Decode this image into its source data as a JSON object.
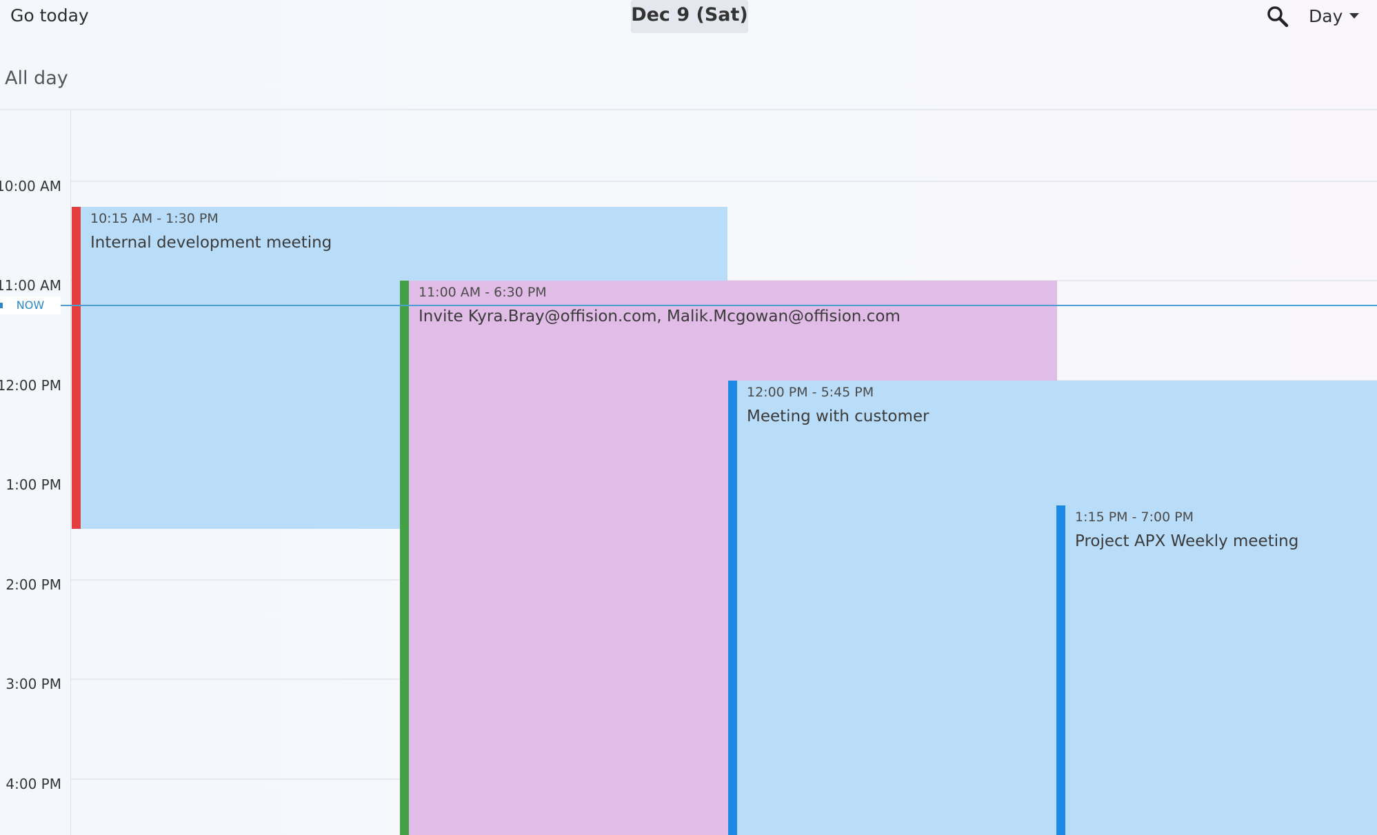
{
  "header": {
    "go_today_label": "Go today",
    "date_title": "Dec 9 (Sat)",
    "search_icon": "search-icon",
    "view_selected": "Day"
  },
  "allday": {
    "label": "All day"
  },
  "grid": {
    "time_labels": [
      "10:00 AM",
      "11:00 AM",
      "12:00 PM",
      "1:00 PM",
      "2:00 PM",
      "3:00 PM",
      "4:00 PM"
    ],
    "now_label": "NOW"
  },
  "events": [
    {
      "time": "10:15 AM - 1:30 PM",
      "title": "Internal development meeting",
      "bar_color": "#e53e3e",
      "bg_color": "#b9ddf8"
    },
    {
      "time": "11:00 AM - 6:30 PM",
      "title": "Invite Kyra.Bray@offision.com, Malik.Mcgowan@offision.com",
      "bar_color": "#43a047",
      "bg_color": "#e1bce6"
    },
    {
      "time": "12:00 PM - 5:45 PM",
      "title": "Meeting with customer",
      "bar_color": "#1e88e5",
      "bg_color": "#b9ddf8"
    },
    {
      "time": "1:15 PM - 7:00 PM",
      "title": "Project APX Weekly meeting",
      "bar_color": "#1e88e5",
      "bg_color": "#b9ddf8"
    }
  ]
}
